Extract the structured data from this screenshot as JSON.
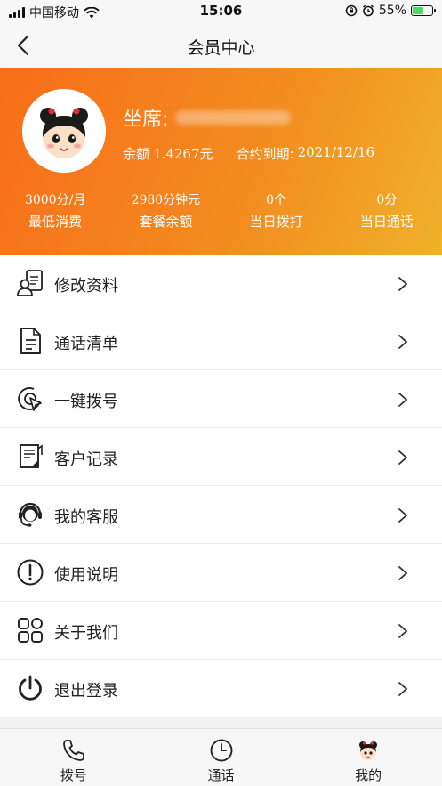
{
  "status_bar": {
    "carrier": "中国移动",
    "time": "15:06",
    "battery": "55%"
  },
  "nav": {
    "title": "会员中心"
  },
  "profile": {
    "seat_label": "坐席:",
    "balance_label": "余额",
    "balance_value": "1.4267元",
    "contract_label": "合约到期:",
    "contract_value": "2021/12/16"
  },
  "stats": [
    {
      "value": "3000分/月",
      "label": "最低消费"
    },
    {
      "value": "2980分钟元",
      "label": "套餐余额"
    },
    {
      "value": "0个",
      "label": "当日拨打"
    },
    {
      "value": "0分",
      "label": "当日通话"
    }
  ],
  "menu": [
    {
      "label": "修改资料",
      "icon": "edit-profile-icon"
    },
    {
      "label": "通话清单",
      "icon": "call-list-icon"
    },
    {
      "label": "一键拨号",
      "icon": "one-click-dial-icon"
    },
    {
      "label": "客户记录",
      "icon": "customer-record-icon"
    },
    {
      "label": "我的客服",
      "icon": "customer-service-icon"
    },
    {
      "label": "使用说明",
      "icon": "instructions-icon"
    },
    {
      "label": "关于我们",
      "icon": "about-us-icon"
    },
    {
      "label": "退出登录",
      "icon": "logout-icon"
    }
  ],
  "tabs": [
    {
      "label": "拨号",
      "icon": "phone-icon"
    },
    {
      "label": "通话",
      "icon": "clock-icon"
    },
    {
      "label": "我的",
      "icon": "avatar-icon"
    }
  ],
  "colors": {
    "header_start": "#f86e1a",
    "header_end": "#efb12a",
    "battery": "#4cd964"
  }
}
